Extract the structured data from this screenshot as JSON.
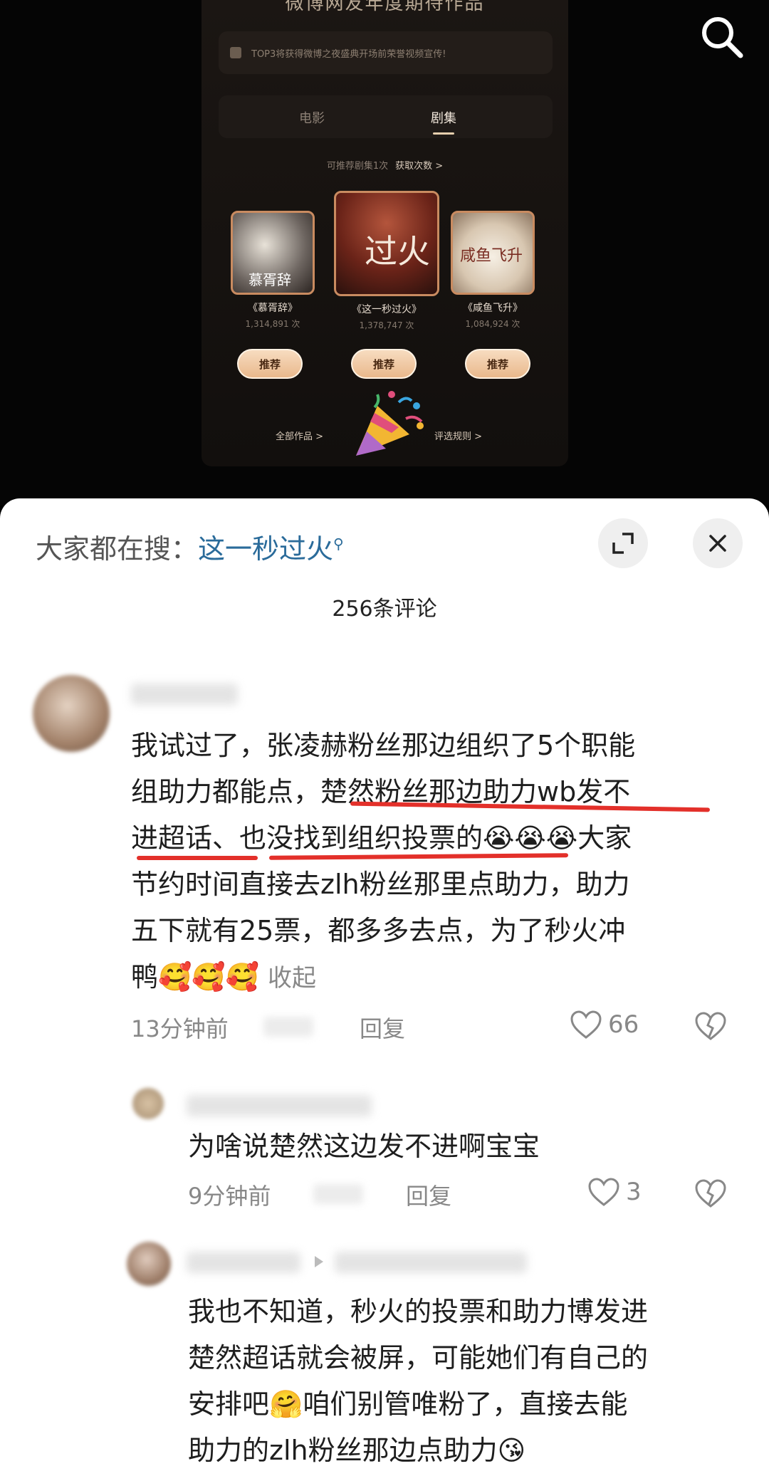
{
  "video": {
    "title": "微博网友年度期待作品",
    "notice": "TOP3将获得微博之夜盛典开场前荣誉视频宣传!",
    "tabs": [
      {
        "label": "电影"
      },
      {
        "label": "剧集"
      }
    ],
    "hint": "可推荐剧集1次",
    "hint_link": "获取次数 >",
    "cards": [
      {
        "poster_text": "慕胥辞",
        "name": "《慕胥辞》",
        "count": "1,314,891 次",
        "button": "推荐"
      },
      {
        "poster_text": "过火",
        "name": "《这一秒过火》",
        "count": "1,378,747 次",
        "button": "推荐"
      },
      {
        "poster_text": "咸鱼飞升",
        "name": "《咸鱼飞升》",
        "count": "1,084,924 次",
        "button": "推荐"
      }
    ],
    "all_works": "全部作品 >",
    "rules": "评选规则 >"
  },
  "sheet": {
    "search_prefix": "大家都在搜：",
    "search_keyword": "这一秒过火",
    "comment_count": "256条评论"
  },
  "comments": [
    {
      "lines": [
        "我试过了，张凌赫粉丝那边组织了5个职能",
        "组助力都能点，楚然粉丝那边助力wb发不",
        "进超话、也没找到组织投票的😭😭😭大家",
        "节约时间直接去zlh粉丝那里点助力，助力",
        "五下就有25票，都多多去点，为了秒火冲"
      ],
      "last_line": "鸭🥰🥰🥰",
      "fold": "收起",
      "time": "13分钟前",
      "reply": "回复",
      "likes": "66"
    },
    {
      "text": "为啥说楚然这边发不进啊宝宝",
      "time": "9分钟前",
      "reply": "回复",
      "likes": "3"
    },
    {
      "lines": [
        "我也不知道，秒火的投票和助力博发进",
        "楚然超话就会被屏，可能她们有自己的",
        "安排吧🤗咱们别管唯粉了，直接去能",
        "助力的zlh粉丝那边点助力😘"
      ]
    }
  ]
}
